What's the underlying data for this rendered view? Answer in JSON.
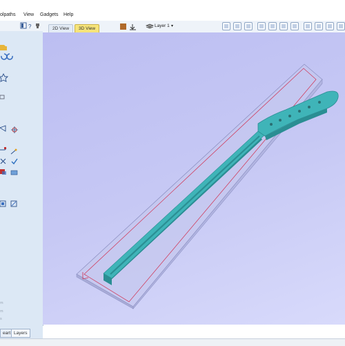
{
  "menubar": {
    "items": [
      "olpaths",
      "View",
      "Gadgets",
      "Help"
    ]
  },
  "left_toolbar": {
    "icons": [
      "layout-icon",
      "help-icon",
      "pin-icon"
    ]
  },
  "tabs": [
    {
      "label": "2D View",
      "active": false
    },
    {
      "label": "3D View",
      "active": true
    }
  ],
  "layer": {
    "label": "Layer 1"
  },
  "left_panel": {
    "text_lines": [
      "m",
      "m",
      "s"
    ]
  },
  "bottom_tabs": [
    {
      "label": "eart",
      "active": false
    },
    {
      "label": "Layers",
      "active": true
    }
  ],
  "colors": {
    "viewport_top": "#bcbef2",
    "viewport_bottom": "#d8dafb",
    "model": "#3fb4b8",
    "model_dark": "#2a8e93",
    "boundary": "#d04060",
    "active_tab": "#f6e47a"
  }
}
